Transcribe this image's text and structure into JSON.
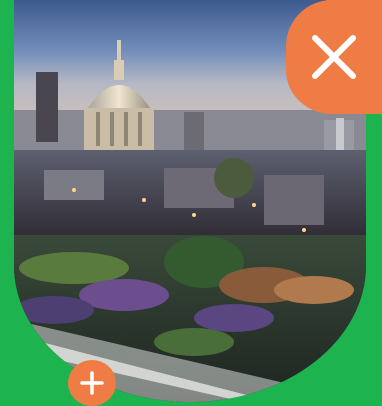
{
  "photo": {
    "icon": "city-skyline-photo",
    "subject": ""
  },
  "controls": {
    "close_icon": "close-icon",
    "add_icon": "plus-icon"
  },
  "colors": {
    "background": "#1db34f",
    "accent": "#ee7c44",
    "icon": "#ffffff"
  }
}
